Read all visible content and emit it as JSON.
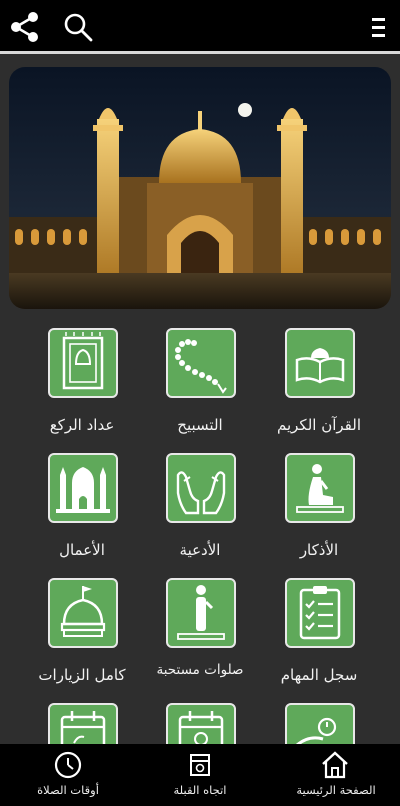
{
  "toolbar": {
    "share_icon": "share-icon",
    "search_icon": "search-icon",
    "menu_icon": "menu-icon"
  },
  "colors": {
    "tile_green": "#5fa95a",
    "background": "#2e2e2e",
    "bars": "#000000"
  },
  "grid": {
    "items": [
      {
        "label": "القرآن الكريم",
        "icon": "quran-book-icon"
      },
      {
        "label": "التسبيح",
        "icon": "prayer-beads-icon"
      },
      {
        "label": "عداد الركع",
        "icon": "prayer-mat-icon"
      },
      {
        "label": "الأذكار",
        "icon": "sitting-prayer-icon"
      },
      {
        "label": "الأدعية",
        "icon": "praying-hands-icon"
      },
      {
        "label": "الأعمال",
        "icon": "mosque-icon"
      },
      {
        "label": "سجل المهام",
        "icon": "checklist-icon"
      },
      {
        "label": "صلوات مستحبة",
        "icon": "standing-prayer-icon"
      },
      {
        "label": "كامل الزيارات",
        "icon": "shrine-dome-icon"
      }
    ]
  },
  "nav": {
    "home": "الصفحة الرئيسية",
    "qibla": "اتجاه القبلة",
    "prayer_times": "أوقات الصلاة"
  }
}
